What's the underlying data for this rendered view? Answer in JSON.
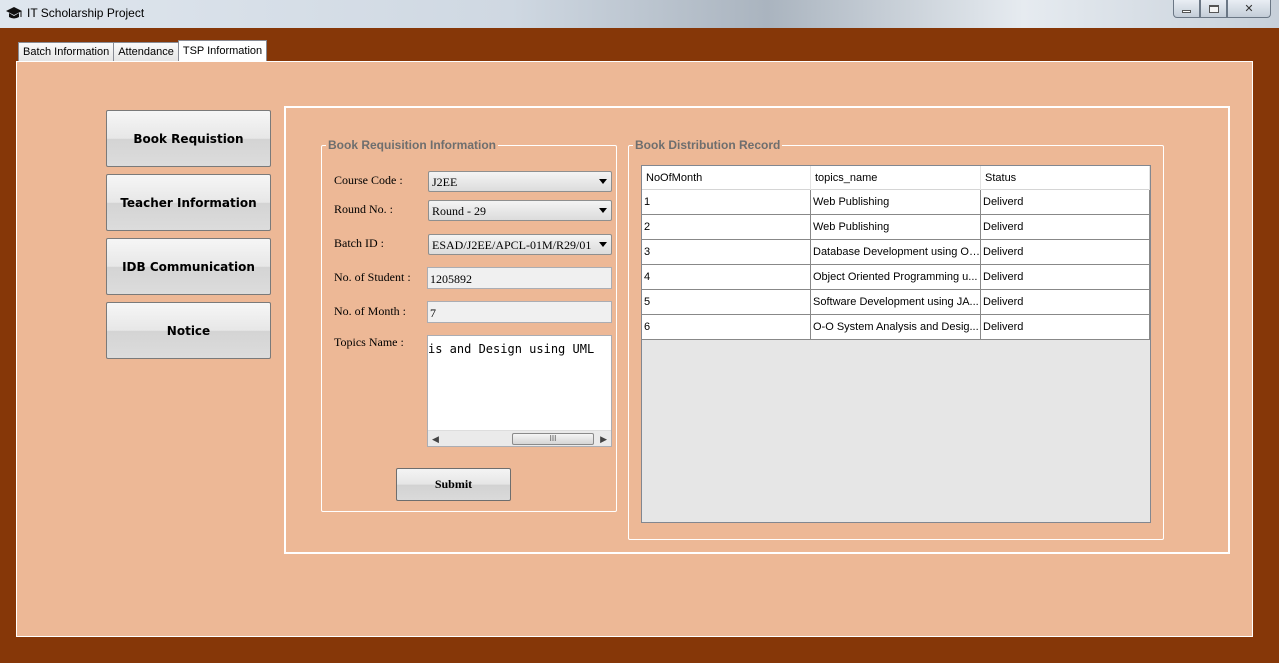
{
  "window": {
    "title": "IT Scholarship Project",
    "controls": {
      "minimize": "▭",
      "maximize": "□",
      "close": "✕"
    }
  },
  "tabs": [
    {
      "label": "Batch Information",
      "active": false
    },
    {
      "label": "Attendance",
      "active": false
    },
    {
      "label": "TSP Information",
      "active": true
    }
  ],
  "side_buttons": [
    "Book Requistion",
    "Teacher Information",
    "IDB Communication",
    "Notice"
  ],
  "book_requisition": {
    "legend": "Book Requisition Information",
    "course_code_label": "Course Code :",
    "course_code_value": "J2EE",
    "round_label": "Round No. :",
    "round_value": "Round - 29",
    "batch_label": "Batch ID :",
    "batch_value": "ESAD/J2EE/APCL-01M/R29/01",
    "students_label": "No. of Student :",
    "students_value": "1205892",
    "month_label": "No. of Month :",
    "month_value": "7",
    "topics_label": "Topics Name :",
    "topics_value": "is and Design using UML",
    "scroll_grip": "III",
    "submit_label": "Submit"
  },
  "distribution": {
    "legend": "Book Distribution Record",
    "columns": [
      "NoOfMonth",
      "topics_name",
      "Status"
    ],
    "rows": [
      [
        "1",
        "Web Publishing",
        "Deliverd"
      ],
      [
        "2",
        "Web Publishing",
        "Deliverd"
      ],
      [
        "3",
        "Database Development using Or...",
        "Deliverd"
      ],
      [
        "4",
        "Object Oriented Programming u...",
        "Deliverd"
      ],
      [
        "5",
        "Software Development using JA...",
        "Deliverd"
      ],
      [
        "6",
        "O-O System Analysis and Desig...",
        "Deliverd"
      ]
    ]
  },
  "colors": {
    "frame": "#863708",
    "panel": "#edb896"
  }
}
